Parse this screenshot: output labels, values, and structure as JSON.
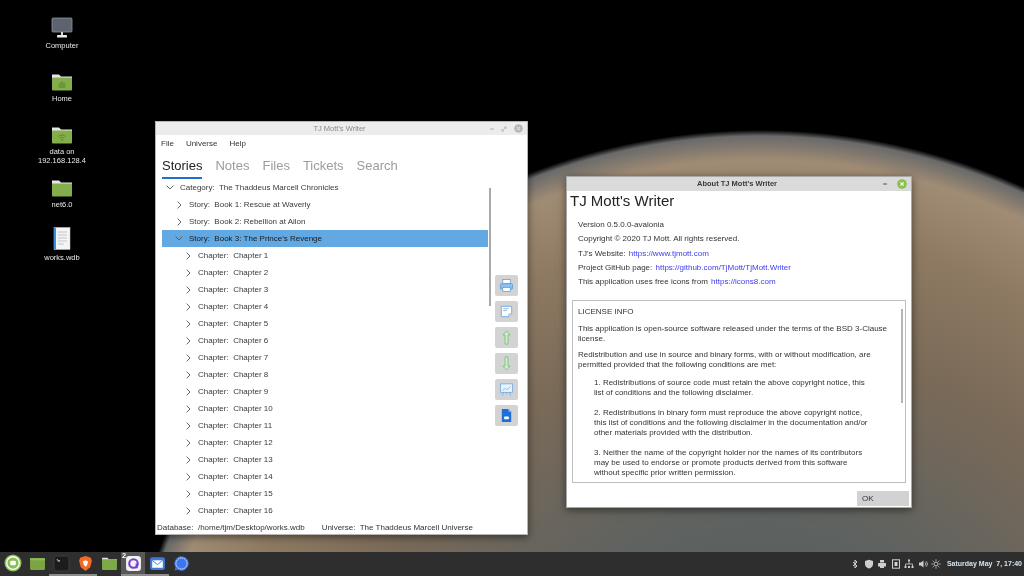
{
  "desktop_icons": [
    {
      "kind": "computer",
      "label": "Computer"
    },
    {
      "kind": "home",
      "label": "Home"
    },
    {
      "kind": "network_folder",
      "label": "data on 192.168.128.4"
    },
    {
      "kind": "folder",
      "label": "net6.0"
    },
    {
      "kind": "document",
      "label": "works.wdb"
    }
  ],
  "writer_window": {
    "title": "TJ Mott's Writer",
    "menu": [
      "File",
      "Universe",
      "Help"
    ],
    "tabs": [
      {
        "label": "Stories",
        "selected": true
      },
      {
        "label": "Notes",
        "selected": false
      },
      {
        "label": "Files",
        "selected": false
      },
      {
        "label": "Tickets",
        "selected": false
      },
      {
        "label": "Search",
        "selected": false
      }
    ],
    "tree": [
      {
        "text": "Category:  The Thaddeus Marcell Chronicles",
        "expanded": true,
        "selected": false,
        "children": [
          {
            "text": "Story:  Book 1: Rescue at Waverly",
            "expanded": false,
            "selected": false
          },
          {
            "text": "Story:  Book 2: Rebellion at Ailon",
            "expanded": false,
            "selected": false
          },
          {
            "text": "Story:  Book 3: The Prince's Revenge",
            "expanded": true,
            "selected": true,
            "children": [
              {
                "text": "Chapter:  Chapter 1",
                "expanded": false,
                "selected": false
              },
              {
                "text": "Chapter:  Chapter 2",
                "expanded": false,
                "selected": false
              },
              {
                "text": "Chapter:  Chapter 3",
                "expanded": false,
                "selected": false
              },
              {
                "text": "Chapter:  Chapter 4",
                "expanded": false,
                "selected": false
              },
              {
                "text": "Chapter:  Chapter 5",
                "expanded": false,
                "selected": false
              },
              {
                "text": "Chapter:  Chapter 6",
                "expanded": false,
                "selected": false
              },
              {
                "text": "Chapter:  Chapter 7",
                "expanded": false,
                "selected": false
              },
              {
                "text": "Chapter:  Chapter 8",
                "expanded": false,
                "selected": false
              },
              {
                "text": "Chapter:  Chapter 9",
                "expanded": false,
                "selected": false
              },
              {
                "text": "Chapter:  Chapter 10",
                "expanded": false,
                "selected": false
              },
              {
                "text": "Chapter:  Chapter 11",
                "expanded": false,
                "selected": false
              },
              {
                "text": "Chapter:  Chapter 12",
                "expanded": false,
                "selected": false
              },
              {
                "text": "Chapter:  Chapter 13",
                "expanded": false,
                "selected": false
              },
              {
                "text": "Chapter:  Chapter 14",
                "expanded": false,
                "selected": false
              },
              {
                "text": "Chapter:  Chapter 15",
                "expanded": false,
                "selected": false
              },
              {
                "text": "Chapter:  Chapter 16",
                "expanded": false,
                "selected": false
              }
            ]
          }
        ]
      }
    ],
    "toolbar": [
      {
        "kind": "print"
      },
      {
        "kind": "note"
      },
      {
        "kind": "move_up"
      },
      {
        "kind": "move_down"
      },
      {
        "kind": "presentation"
      },
      {
        "kind": "word_export"
      }
    ],
    "status_bar": {
      "database": "Database:  /home/tjm/Desktop/works.wdb",
      "universe": "Universe:  The Thaddeus Marcell Universe"
    }
  },
  "about_dialog": {
    "title": "About TJ Mott's Writer",
    "heading": "TJ Mott's Writer",
    "info_lines": [
      {
        "text": "Version 0.5.0.0-avalonia"
      },
      {
        "text": "Copyright © 2020 TJ Mott. All rights reserved."
      },
      {
        "text": "TJ's Website:",
        "link": "https://www.tjmott.com"
      },
      {
        "text": "Project GitHub page:",
        "link": "https://github.com/TjMott/TjMott.Writer"
      },
      {
        "text": "This application uses free icons from",
        "link": "https://icons8.com"
      }
    ],
    "license": {
      "heading": "LICENSE INFO",
      "paragraphs": [
        "This application is open-source software released under the terms of the BSD 3-Clause license.",
        "Redistribution and use in source and binary forms, with or without modification, are permitted provided that the following conditions are met:"
      ],
      "clauses": [
        "1.  Redistributions of source code must retain the above copyright notice, this list of conditions and the following disclaimer.",
        "2.  Redistributions in binary form must reproduce the above copyright notice, this list of conditions and the following disclaimer in the documentation and/or other materials provided with the distribution.",
        "3.  Neither the name of the copyright holder nor the names of its contributors may be used to endorse or promote products derived from this software without specific prior written permission."
      ]
    },
    "ok_button": "OK"
  },
  "taskbar": {
    "launchers": [
      {
        "kind": "menu",
        "active": false,
        "running": false
      },
      {
        "kind": "show_desktop",
        "active": false,
        "running": false
      },
      {
        "kind": "terminal",
        "active": false,
        "running": true
      },
      {
        "kind": "browser",
        "active": false,
        "running": true
      },
      {
        "kind": "files",
        "active": false,
        "running": false
      },
      {
        "kind": "ring_app",
        "active": true,
        "running": true,
        "badge": "2"
      },
      {
        "kind": "mail",
        "active": false,
        "running": true
      },
      {
        "kind": "chat",
        "active": false,
        "running": false
      }
    ],
    "clock": "Saturday May  7, 17:40"
  }
}
